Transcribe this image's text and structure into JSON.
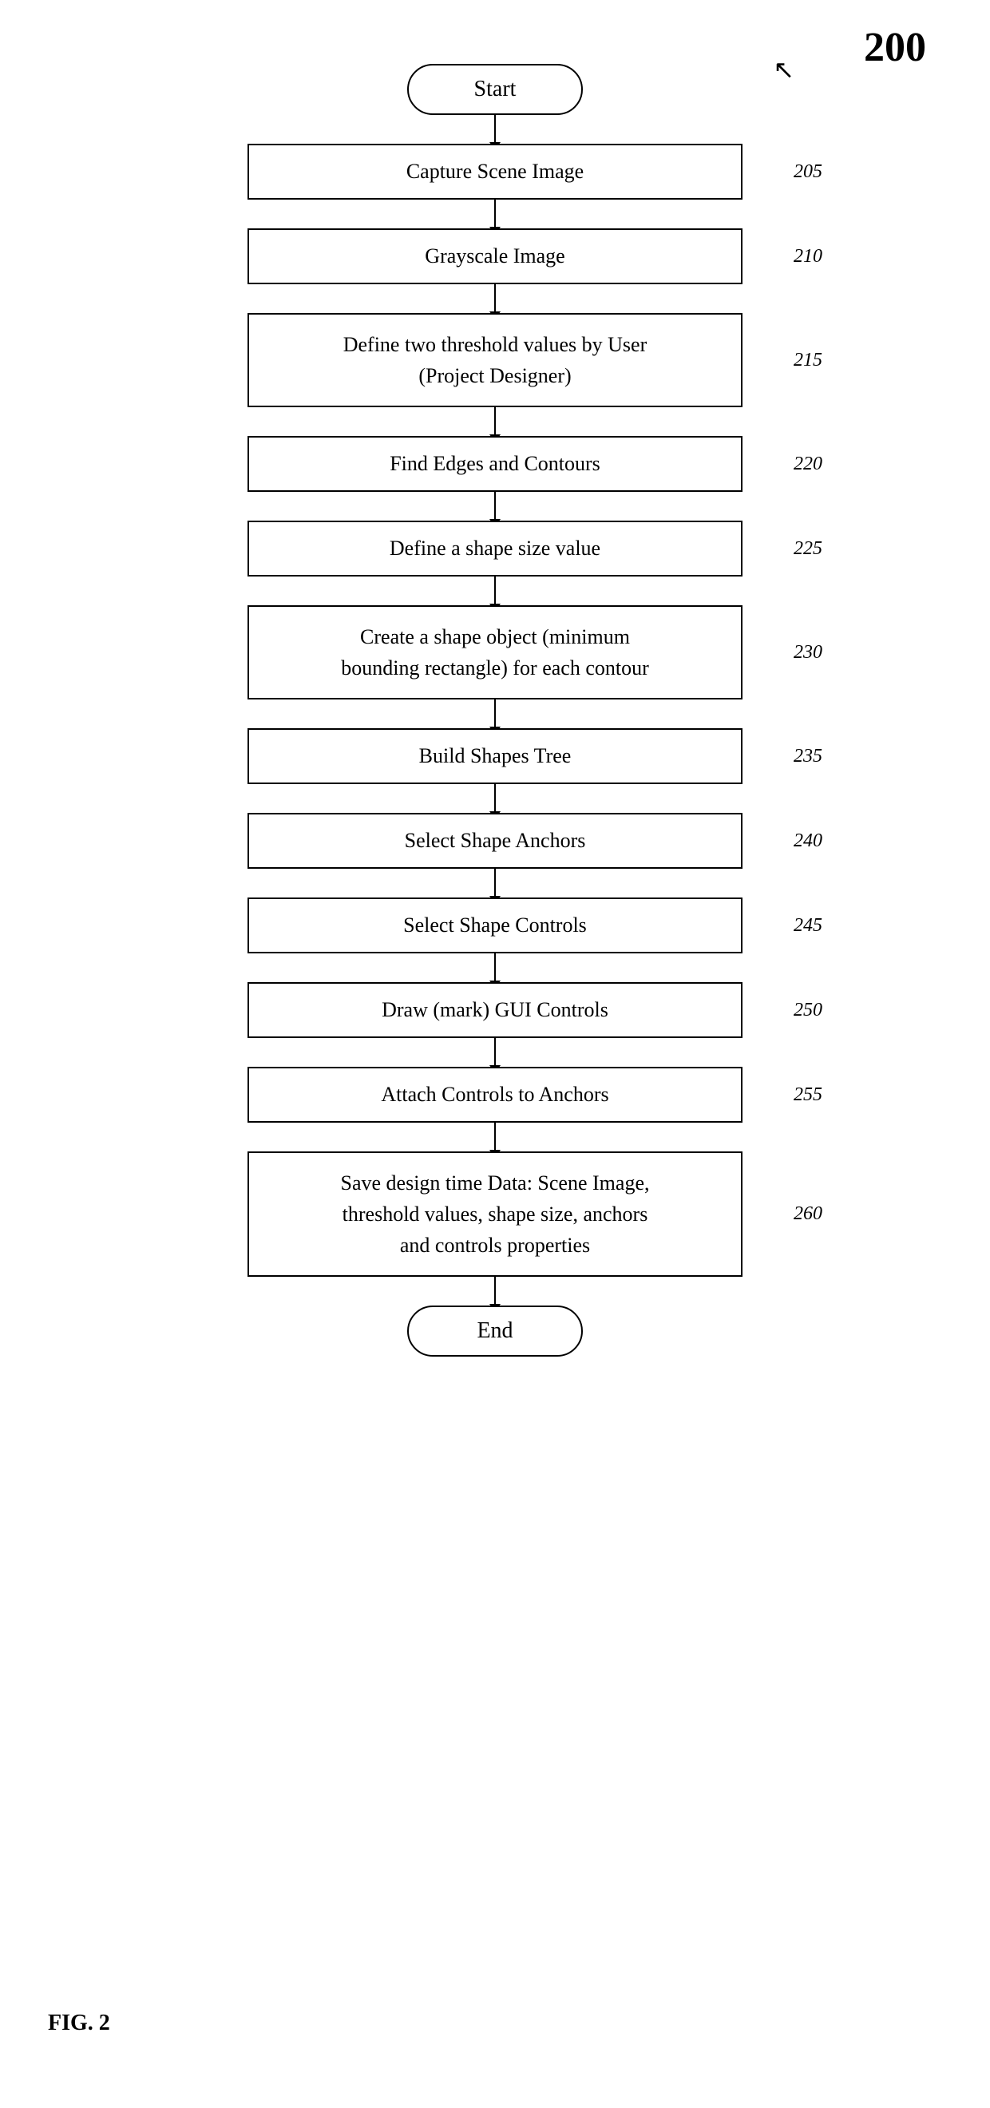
{
  "diagram": {
    "id": "200",
    "fig_label": "FIG. 2",
    "start_label": "Start",
    "end_label": "End",
    "steps": [
      {
        "id": "205",
        "text": "Capture Scene Image"
      },
      {
        "id": "210",
        "text": "Grayscale Image"
      },
      {
        "id": "215",
        "text": "Define two threshold values by User\n(Project Designer)"
      },
      {
        "id": "220",
        "text": "Find Edges and Contours"
      },
      {
        "id": "225",
        "text": "Define a shape size value"
      },
      {
        "id": "230",
        "text": "Create a shape object (minimum\nbounding rectangle) for each contour"
      },
      {
        "id": "235",
        "text": "Build Shapes Tree"
      },
      {
        "id": "240",
        "text": "Select Shape Anchors"
      },
      {
        "id": "245",
        "text": "Select Shape Controls"
      },
      {
        "id": "250",
        "text": "Draw (mark) GUI Controls"
      },
      {
        "id": "255",
        "text": "Attach Controls to Anchors"
      },
      {
        "id": "260",
        "text": "Save design time Data: Scene Image,\nthreshold values, shape size, anchors\nand controls properties"
      }
    ]
  }
}
